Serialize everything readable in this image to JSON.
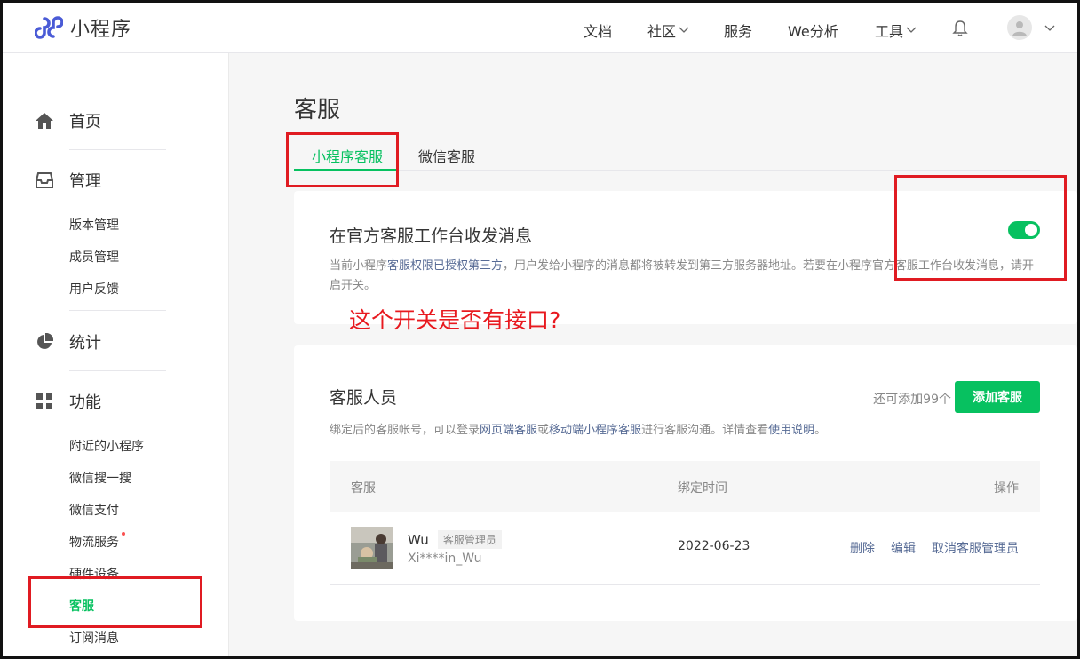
{
  "app": {
    "title": "小程序",
    "brand_color": "#07c160",
    "logo_color": "#4a5bd6"
  },
  "nav": {
    "items": [
      {
        "label": "文档",
        "dropdown": false
      },
      {
        "label": "社区",
        "dropdown": true
      },
      {
        "label": "服务",
        "dropdown": false
      },
      {
        "label": "We分析",
        "dropdown": false
      },
      {
        "label": "工具",
        "dropdown": true
      }
    ],
    "icons": [
      "bell-icon",
      "avatar-icon",
      "chevron-down-icon"
    ]
  },
  "sidebar": {
    "groups": [
      {
        "label": "首页",
        "icon": "home-icon"
      },
      {
        "label": "管理",
        "icon": "inbox-icon",
        "items": [
          "版本管理",
          "成员管理",
          "用户反馈"
        ]
      },
      {
        "label": "统计",
        "icon": "pie-chart-icon"
      },
      {
        "label": "功能",
        "icon": "grid-icon",
        "items": [
          "附近的小程序",
          "微信搜一搜",
          "微信支付",
          "物流服务",
          "硬件设备",
          "客服",
          "订阅消息"
        ]
      }
    ],
    "active_item": "客服"
  },
  "main": {
    "page_title": "客服",
    "tabs": [
      {
        "label": "小程序客服",
        "active": true
      },
      {
        "label": "微信客服",
        "active": false
      }
    ],
    "workbench": {
      "title": "在官方客服工作台收发消息",
      "desc_before": "当前小程序",
      "desc_link": "客服权限已授权第三方",
      "desc_after": "，用户发给小程序的消息都将被转发到第三方服务器地址。若要在小程序官方客服工作台收发消息，请开启开关。",
      "toggle_on": true
    },
    "staff": {
      "title": "客服人员",
      "remaining": "还可添加99个",
      "add_button": "添加客服",
      "desc_1": "绑定后的客服帐号，可以登录",
      "desc_link_1": "网页端客服",
      "desc_2": "或",
      "desc_link_2": "移动端小程序客服",
      "desc_3": "进行客服沟通。详情查看",
      "desc_link_3": "使用说明",
      "desc_4": "。",
      "columns": [
        "客服",
        "绑定时间",
        "操作"
      ],
      "rows": [
        {
          "name": "Wu",
          "role": "客服管理员",
          "account": "Xi****in_Wu",
          "bind_time": "2022-06-23",
          "actions": [
            "删除",
            "编辑",
            "取消客服管理员"
          ]
        }
      ]
    }
  },
  "annotation": {
    "text": "这个开关是否有接口?",
    "color": "#e01b22"
  }
}
